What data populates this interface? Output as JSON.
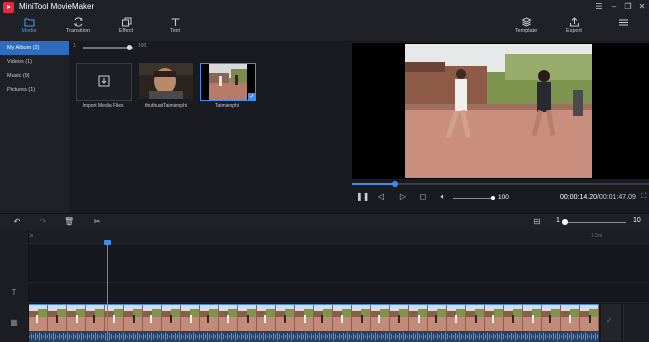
{
  "app": {
    "title": "MiniTool MovieMaker"
  },
  "toolbar": {
    "media": "Media",
    "transition": "Transition",
    "effect": "Effect",
    "text": "Text",
    "template": "Template",
    "export": "Export"
  },
  "sidebar": {
    "items": [
      {
        "label": "My Album  (2)",
        "active": true
      },
      {
        "label": "Videos  (1)"
      },
      {
        "label": "Music  (9)"
      },
      {
        "label": "Pictures  (1)"
      }
    ]
  },
  "media": {
    "zoom_min": "1",
    "zoom_max": "100",
    "tiles": [
      {
        "label": "Import Media Files",
        "icon": "import-icon"
      },
      {
        "label": "thuthuatTaimienphi"
      },
      {
        "label": "Taimienphi",
        "checked": true
      }
    ]
  },
  "preview": {
    "progress": 0.145,
    "volume_value": 100,
    "time_current": "00:00:14.20",
    "time_total": "/00:01:47.09"
  },
  "timeline_toolbar": {
    "zoom_min": "1",
    "zoom_max": "10",
    "zoom_level": 1
  },
  "timeline": {
    "ruler_start": "0s",
    "ruler_mark": "1.5m"
  },
  "colors": {
    "accent": "#3d8ef0",
    "selected": "#2e6cc0",
    "background": "#1a1b20",
    "panel": "#202127"
  }
}
